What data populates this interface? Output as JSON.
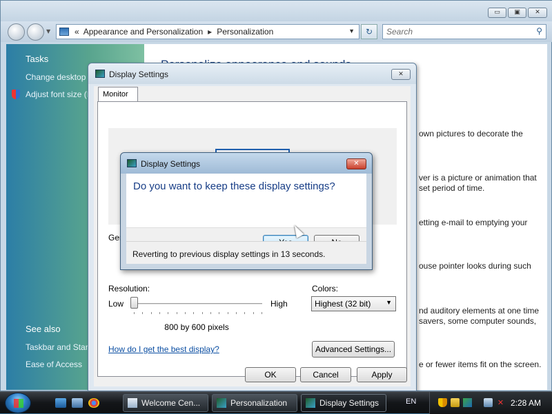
{
  "explorer": {
    "breadcrumb": [
      "Appearance and Personalization",
      "Personalization"
    ],
    "breadcrumb_prefix": "«",
    "search_placeholder": "Search",
    "window_buttons": {
      "minimize": "▭",
      "maximize": "▣",
      "close": "✕"
    }
  },
  "sidebar": {
    "tasks_heading": "Tasks",
    "tasks": [
      "Change desktop i",
      "Adjust font size (D"
    ],
    "see_also_heading": "See also",
    "see_also": [
      "Taskbar and Start",
      "Ease of Access"
    ]
  },
  "content": {
    "heading": "Personalize appearance and sounds",
    "descriptions": [
      "own pictures to decorate the",
      "ver is a picture or animation that",
      "set period of time.",
      "etting e-mail to emptying your",
      "ouse pointer looks during such",
      "nd auditory elements at one time",
      "savers, some computer sounds,",
      "e or fewer items fit on the screen."
    ]
  },
  "display_settings": {
    "title": "Display Settings",
    "close_glyph": "✕",
    "tab": "Monitor",
    "general_label": "Gen",
    "resolution_label": "Resolution:",
    "low_label": "Low",
    "high_label": "High",
    "resolution_value": "800 by 600 pixels",
    "resolution_slider_position": 0,
    "colors_label": "Colors:",
    "colors_value": "Highest (32 bit)",
    "help_link": "How do I get the best display?",
    "advanced_button": "Advanced Settings...",
    "ok_button": "OK",
    "cancel_button": "Cancel",
    "apply_button": "Apply"
  },
  "confirm_dialog": {
    "title": "Display Settings",
    "close_glyph": "✕",
    "question": "Do you want to keep these display settings?",
    "yes_button": "Yes",
    "no_button": "No",
    "revert_message": "Reverting to previous display settings in 13 seconds."
  },
  "taskbar": {
    "tasks": [
      {
        "label": "Welcome Cen...",
        "active": false
      },
      {
        "label": "Personalization",
        "active": false
      },
      {
        "label": "Display Settings",
        "active": true
      }
    ],
    "language": "EN",
    "clock": "2:28 AM"
  },
  "colors": {
    "link": "#0b4ea2",
    "question_text": "#173d86",
    "sidebar_top": "#2c7ea6",
    "sidebar_bottom": "#7ec0a2",
    "close_red": "#c9402c"
  }
}
